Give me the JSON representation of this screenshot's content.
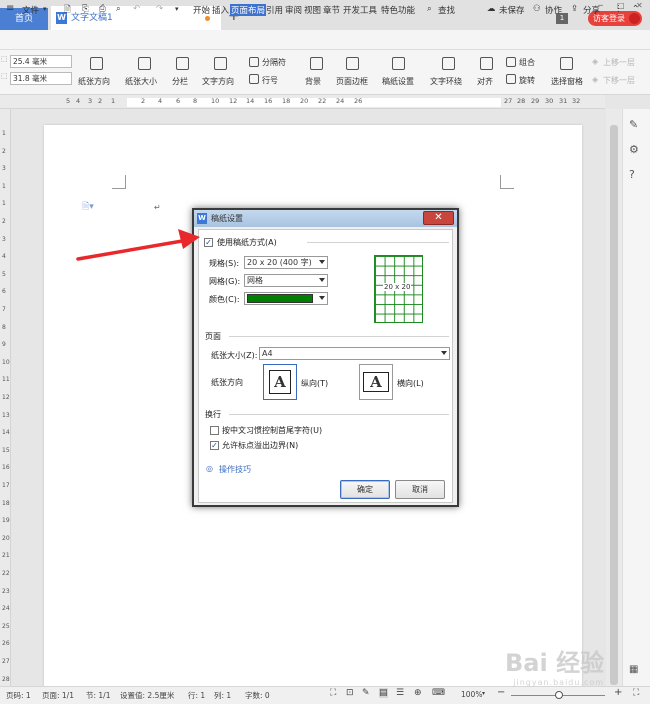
{
  "tabbar": {
    "home": "首页",
    "doc_tab": "文字文稿1",
    "new_tab": "+",
    "tab_count": "1",
    "visitor": "访客登录"
  },
  "menu": {
    "items": [
      "文件",
      "开始",
      "插入",
      "页面布局",
      "引用",
      "审阅",
      "视图",
      "章节",
      "开发工具",
      "特色功能"
    ],
    "active": "页面布局",
    "search": "查找",
    "unsaved": "未保存",
    "collab": "协作",
    "share": "分享"
  },
  "ribbon": {
    "margin_top": "25.4 毫米",
    "margin_bottom": "31.8 毫米",
    "buttons": [
      "纸张方向",
      "纸张大小",
      "分栏",
      "文字方向",
      "分隔符",
      "行号",
      "背景",
      "页面边框",
      "稿纸设置",
      "文字环绕",
      "对齐",
      "组合",
      "旋转",
      "选择窗格",
      "上移一层",
      "下移一层"
    ]
  },
  "ruler": {
    "h_numbers": [
      "5",
      "4",
      "3",
      "2",
      "1",
      "2",
      "4",
      "6",
      "8",
      "10",
      "12",
      "14",
      "16",
      "18",
      "20",
      "22",
      "24",
      "26",
      "27",
      "28",
      "29",
      "30",
      "31",
      "32"
    ],
    "v_numbers": [
      "1",
      "2",
      "3",
      "1",
      "1",
      "2",
      "3",
      "4",
      "5",
      "6",
      "7",
      "8",
      "9",
      "10",
      "11",
      "12",
      "13",
      "14",
      "15",
      "16",
      "17",
      "18",
      "19",
      "20",
      "21",
      "22",
      "23",
      "24",
      "25",
      "26",
      "27",
      "28"
    ]
  },
  "dialog": {
    "title": "稿纸设置",
    "use_grid_label": "使用稿纸方式(A)",
    "spec_label": "规格(S):",
    "spec_value": "20 x 20 (400 字)",
    "grid_label": "网格(G):",
    "grid_value": "网格",
    "color_label": "颜色(C):",
    "color_value": "#008000",
    "preview_text": "20 x 20",
    "page_section": "页面",
    "paper_size_label": "纸张大小(Z):",
    "paper_size_value": "A4",
    "orientation_label": "纸张方向",
    "portrait_label": "纵向(T)",
    "landscape_label": "横向(L)",
    "wrap_section": "换行",
    "cjk_control_label": "按中文习惯控制首尾字符(U)",
    "overflow_label": "允许标点溢出边界(N)",
    "tips_label": "操作技巧",
    "ok": "确定",
    "cancel": "取消"
  },
  "status": {
    "page_no": "页码: 1",
    "page": "页面: 1/1",
    "section": "节: 1/1",
    "setting": "设置值: 2.5厘米",
    "row": "行: 1",
    "col": "列: 1",
    "words": "字数: 0",
    "zoom": "100%"
  },
  "watermark": {
    "text": "Bai 经验",
    "sub": "jingyan.baidu.com"
  },
  "colors": {
    "accent": "#3c73cf",
    "grid_green": "#008000",
    "arrow_red": "#e8282a"
  }
}
